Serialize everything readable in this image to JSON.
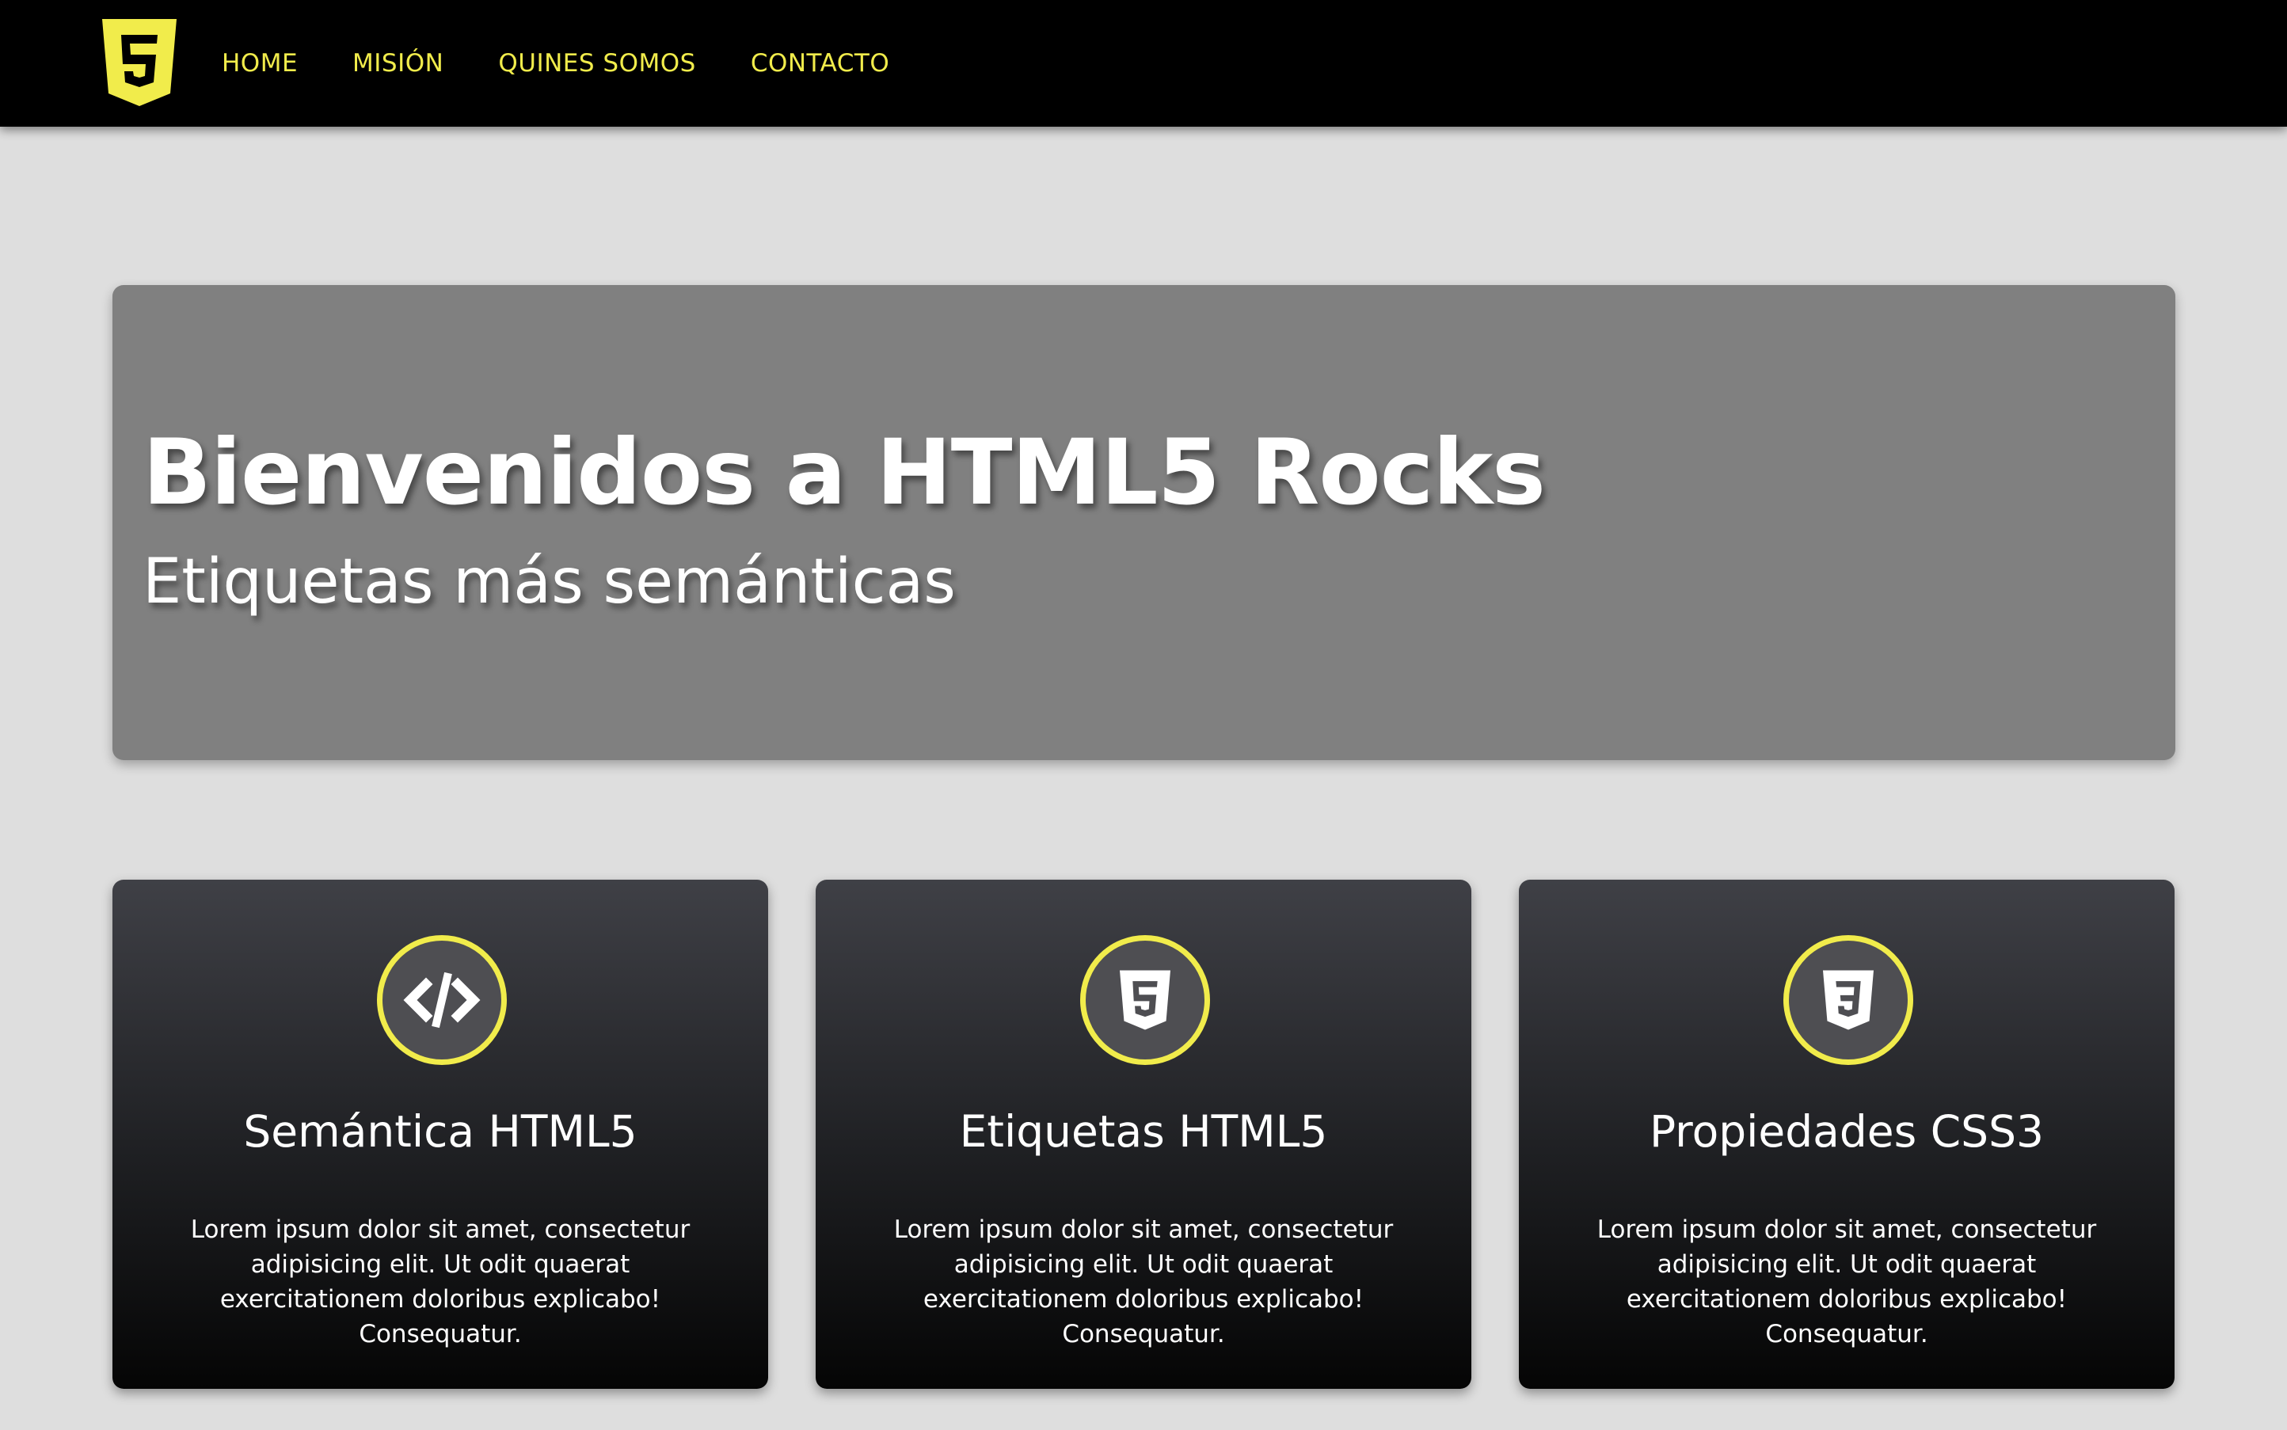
{
  "nav": {
    "items": [
      {
        "label": "HOME"
      },
      {
        "label": "MISIÓN"
      },
      {
        "label": "QUINES SOMOS"
      },
      {
        "label": "CONTACTO"
      }
    ]
  },
  "hero": {
    "title": "Bienvenidos a HTML5 Rocks",
    "subtitle": "Etiquetas más semánticas"
  },
  "cards": [
    {
      "icon": "code-icon",
      "title": "Semántica HTML5",
      "text": "Lorem ipsum dolor sit amet, consectetur adipisicing elit. Ut odit quaerat exercitationem doloribus explicabo! Consequatur."
    },
    {
      "icon": "html5-icon",
      "title": "Etiquetas HTML5",
      "text": "Lorem ipsum dolor sit amet, consectetur adipisicing elit. Ut odit quaerat exercitationem doloribus explicabo! Consequatur."
    },
    {
      "icon": "css3-icon",
      "title": "Propiedades CSS3",
      "text": "Lorem ipsum dolor sit amet, consectetur adipisicing elit. Ut odit quaerat exercitationem doloribus explicabo! Consequatur."
    }
  ],
  "colors": {
    "accent": "#f1ec4b",
    "topbar": "#000000",
    "background": "#dedede",
    "hero": "#808080"
  }
}
